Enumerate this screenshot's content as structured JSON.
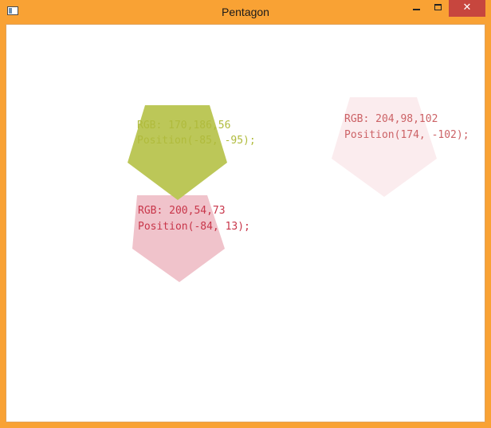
{
  "window": {
    "title": "Pentagon",
    "icon": "app-window-icon",
    "controls": {
      "minimize_icon": "minimize-icon",
      "maximize_icon": "maximize-icon",
      "close_glyph": "✕"
    }
  },
  "shapes": [
    {
      "name": "pentagon-green",
      "fill": "#bcc758",
      "text_color": "#b0bb3c",
      "rgb_label": "RGB: 170,186,56",
      "position_label": "Position(-85, -95);"
    },
    {
      "name": "pentagon-pink",
      "fill": "#f0c3cb",
      "text_color": "#c8364a",
      "rgb_label": "RGB: 200,54,73",
      "position_label": "Position(-84, 13);"
    },
    {
      "name": "pentagon-lightpink",
      "fill": "#fbecee",
      "text_color": "#cc6266",
      "rgb_label": "RGB: 204,98,102",
      "position_label": "Position(174, -102);"
    }
  ]
}
